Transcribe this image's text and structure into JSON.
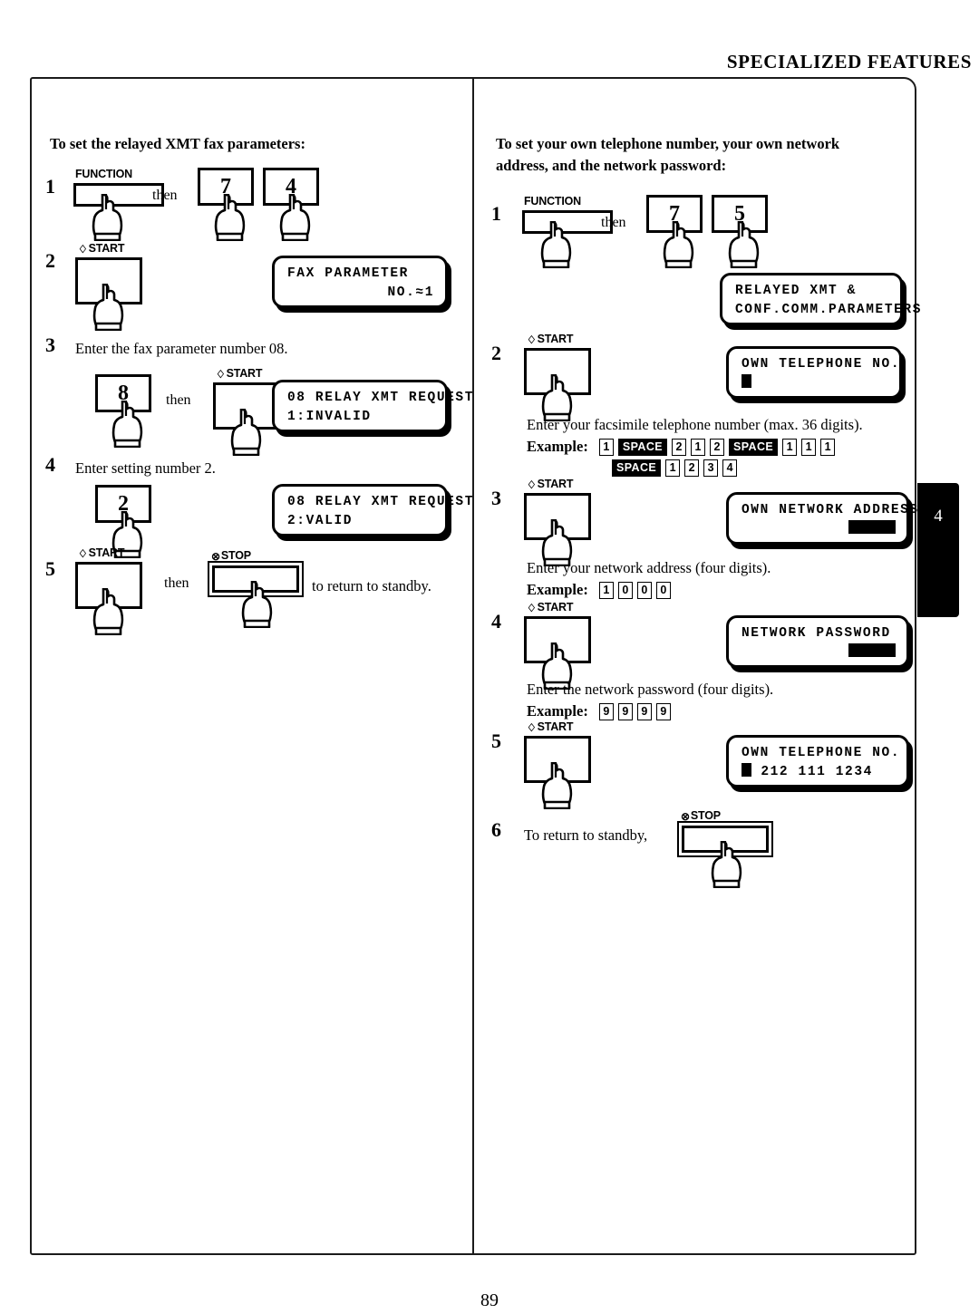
{
  "page": {
    "header": "SPECIALIZED FEATURES",
    "number": "89",
    "side_tab": "4"
  },
  "left_column": {
    "intro": "To set the relayed XMT fax parameters:",
    "steps": [
      {
        "num": "1",
        "keys": [
          "FUNCTION",
          "7",
          "4"
        ],
        "then": "then"
      },
      {
        "num": "2",
        "key": "START",
        "lcd": {
          "line1": "FAX PARAMETER",
          "line2": "NO.≈1"
        }
      },
      {
        "num": "3",
        "text": "Enter the fax parameter number 08.",
        "key_digit": "8",
        "then": "then",
        "key_start": "START",
        "lcd": {
          "line1": "08 RELAY XMT REQUEST",
          "line2": "1:INVALID"
        }
      },
      {
        "num": "4",
        "text": "Enter setting number 2.",
        "key_digit": "2",
        "lcd": {
          "line1": "08 RELAY XMT REQUEST",
          "line2": "2:VALID"
        }
      },
      {
        "num": "5",
        "key_start": "START",
        "then": "then",
        "key_stop": "STOP",
        "trailing_text": "to return to standby."
      }
    ]
  },
  "right_column": {
    "intro_line1": "To set your own telephone number, your own network",
    "intro_line2": "address, and the network password:",
    "steps": [
      {
        "num": "1",
        "keys": [
          "FUNCTION",
          "7",
          "5"
        ],
        "then": "then",
        "lcd": {
          "line1": "RELAYED XMT &",
          "line2": "CONF.COMM.PARAMETERS"
        }
      },
      {
        "num": "2",
        "key": "START",
        "lcd": {
          "line1": "OWN TELEPHONE NO.",
          "line2": ""
        },
        "instruction": "Enter your facsimile telephone number (max. 36 digits).",
        "example_label": "Example:",
        "example_row1": [
          "1",
          "SPACE",
          "2",
          "1",
          "2",
          "SPACE",
          "1",
          "1",
          "1"
        ],
        "example_row2": [
          "SPACE",
          "1",
          "2",
          "3",
          "4"
        ]
      },
      {
        "num": "3",
        "key": "START",
        "lcd": {
          "line1": "OWN NETWORK ADDRESS",
          "line2": ""
        },
        "instruction": "Enter your network address (four digits).",
        "example_label": "Example:",
        "example_row1": [
          "1",
          "0",
          "0",
          "0"
        ]
      },
      {
        "num": "4",
        "key": "START",
        "lcd": {
          "line1": "NETWORK PASSWORD",
          "line2": ""
        },
        "instruction": "Enter the network password (four digits).",
        "example_label": "Example:",
        "example_row1": [
          "9",
          "9",
          "9",
          "9"
        ]
      },
      {
        "num": "5",
        "key": "START",
        "lcd": {
          "line1": "OWN TELEPHONE NO.",
          "line2": "212 111 1234"
        }
      },
      {
        "num": "6",
        "text": "To return to standby,",
        "key_stop": "STOP"
      }
    ]
  },
  "icons": {
    "start_glyph": "♢",
    "stop_glyph": "⊗",
    "hand": "pointing-hand"
  }
}
